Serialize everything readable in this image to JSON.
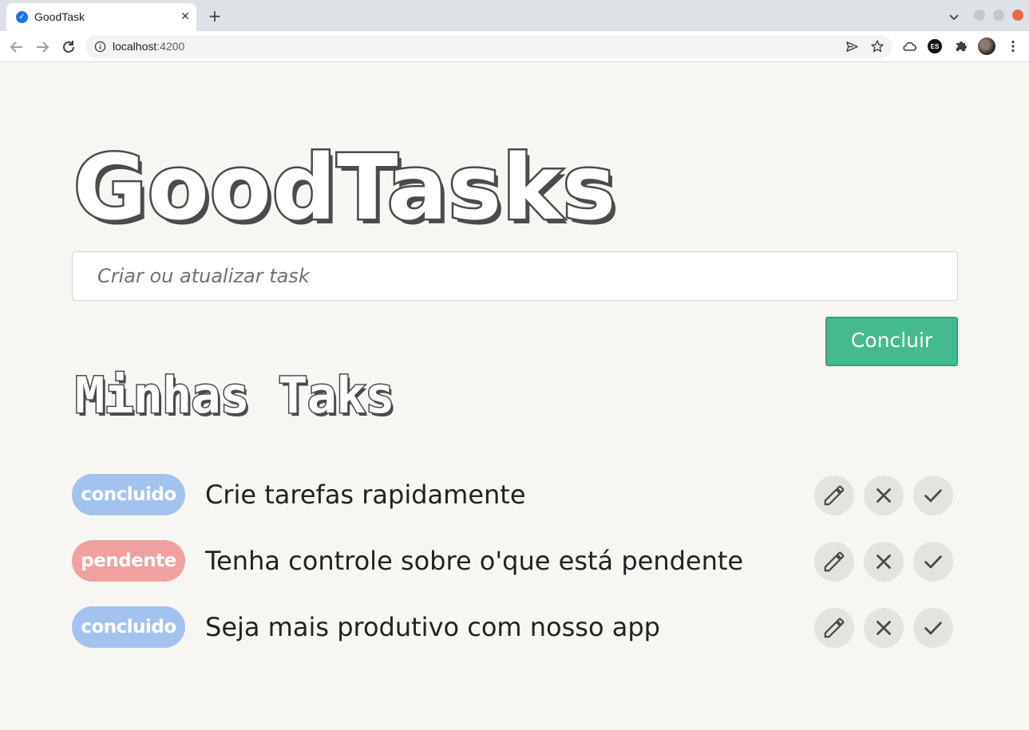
{
  "browser": {
    "tab_title": "GoodTask",
    "url_host": "localhost",
    "url_port": ":4200",
    "extension_badge": "ES"
  },
  "app": {
    "title": "GoodTasks",
    "input_placeholder": "Criar ou atualizar task",
    "submit_label": "Concluir",
    "section_title": "Minhas Taks"
  },
  "tasks": [
    {
      "status": "concluido",
      "status_color": "#a3c3ee",
      "text": "Crie tarefas rapidamente"
    },
    {
      "status": "pendente",
      "status_color": "#f0a0a0",
      "text": "Tenha controle sobre o'que está pendente"
    },
    {
      "status": "concluido",
      "status_color": "#a3c3ee",
      "text": "Seja mais produtivo com nosso app"
    }
  ],
  "icons": {
    "edit": "pencil-icon",
    "delete": "close-icon",
    "complete": "check-icon"
  },
  "colors": {
    "accent": "#46ba8f",
    "background": "#f7f6f2",
    "title_outline": "#4b4b4b"
  }
}
